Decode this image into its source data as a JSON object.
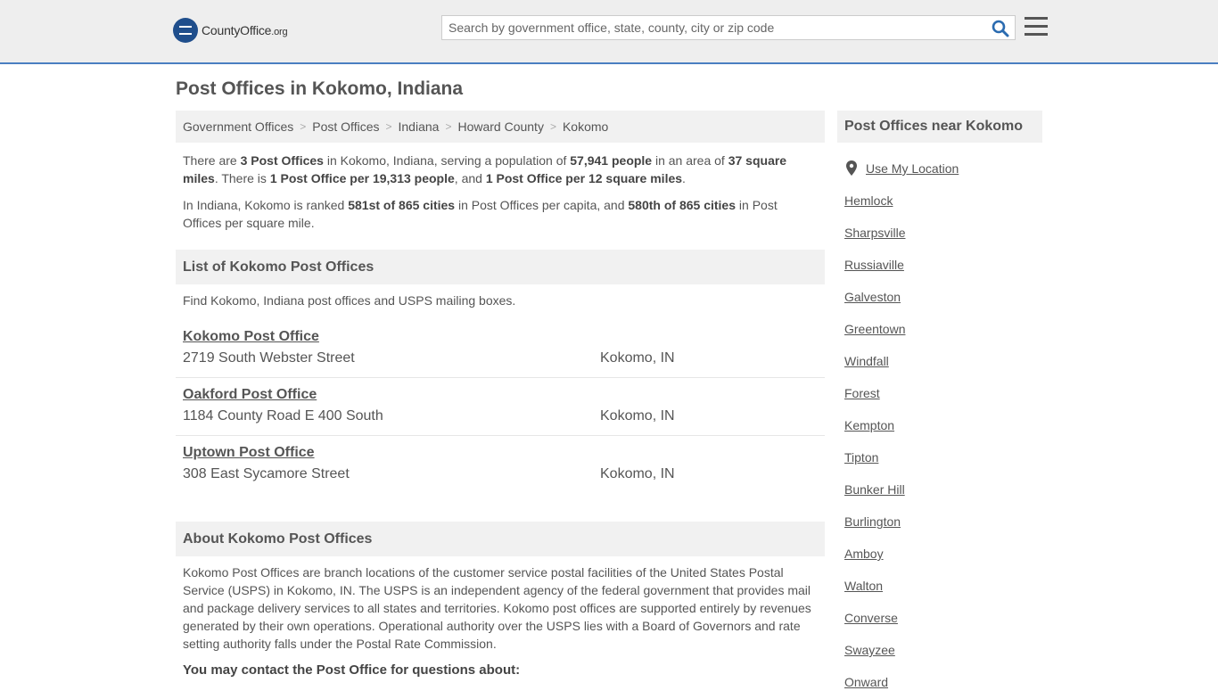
{
  "header": {
    "logo_main": "CountyOffice",
    "logo_suffix": ".org",
    "search_placeholder": "Search by government office, state, county, city or zip code"
  },
  "page_title": "Post Offices in Kokomo, Indiana",
  "breadcrumb": [
    "Government Offices",
    "Post Offices",
    "Indiana",
    "Howard County",
    "Kokomo"
  ],
  "summary": {
    "p1": [
      "There are ",
      "3 Post Offices",
      " in Kokomo, Indiana, serving a population of ",
      "57,941 people",
      " in an area of ",
      "37 square miles",
      ". There is ",
      "1 Post Office per 19,313 people",
      ", and ",
      "1 Post Office per 12 square miles",
      "."
    ],
    "p2": [
      "In Indiana, Kokomo is ranked ",
      "581st of 865 cities",
      " in Post Offices per capita, and ",
      "580th of 865 cities",
      " in Post Offices per square mile."
    ]
  },
  "list_section": {
    "title": "List of Kokomo Post Offices",
    "intro": "Find Kokomo, Indiana post offices and USPS mailing boxes.",
    "offices": [
      {
        "name": "Kokomo Post Office",
        "address": "2719 South Webster Street",
        "city": "Kokomo, IN"
      },
      {
        "name": "Oakford Post Office",
        "address": "1184 County Road E 400 South",
        "city": "Kokomo, IN"
      },
      {
        "name": "Uptown Post Office",
        "address": "308 East Sycamore Street",
        "city": "Kokomo, IN"
      }
    ]
  },
  "about_section": {
    "title": "About Kokomo Post Offices",
    "text": "Kokomo Post Offices are branch locations of the customer service postal facilities of the United States Postal Service (USPS) in Kokomo, IN. The USPS is an independent agency of the federal government that provides mail and package delivery services to all states and territories. Kokomo post offices are supported entirely by revenues generated by their own operations. Operational authority over the USPS lies with a Board of Governors and rate setting authority falls under the Postal Rate Commission.",
    "contact_heading": "You may contact the Post Office for questions about:"
  },
  "sidebar": {
    "title": "Post Offices near Kokomo",
    "use_location": "Use My Location",
    "nearby": [
      "Hemlock",
      "Sharpsville",
      "Russiaville",
      "Galveston",
      "Greentown",
      "Windfall",
      "Forest",
      "Kempton",
      "Tipton",
      "Bunker Hill",
      "Burlington",
      "Amboy",
      "Walton",
      "Converse",
      "Swayzee",
      "Onward"
    ]
  },
  "colors": {
    "header_bg": "#eeeeee",
    "header_border": "#4b7fc1",
    "search_icon": "#2a6bb0",
    "section_bg": "#f1f1f1",
    "text": "#555555"
  }
}
